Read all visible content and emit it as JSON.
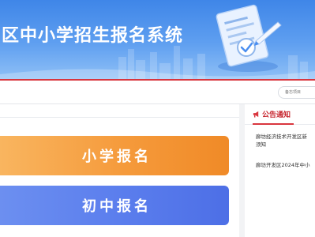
{
  "header": {
    "title": "区中小学招生报名系统"
  },
  "toolbar": {
    "search_placeholder": "备忘项目"
  },
  "main": {
    "buttons": [
      {
        "label": "小学报名"
      },
      {
        "label": "初中报名"
      }
    ]
  },
  "notices": {
    "title": "公告通知",
    "items": [
      {
        "line1": "廊坊经济技术开发区新",
        "line2": "须知"
      },
      {
        "line1": "廊坊开发区2024年中小"
      }
    ]
  },
  "colors": {
    "header_blue": "#4a8ef0",
    "accent_red": "#d9363e",
    "primary_orange": "#f59a3b",
    "junior_blue": "#5a7ded"
  },
  "icons": [
    "document-check-illustration",
    "bullhorn-icon"
  ]
}
